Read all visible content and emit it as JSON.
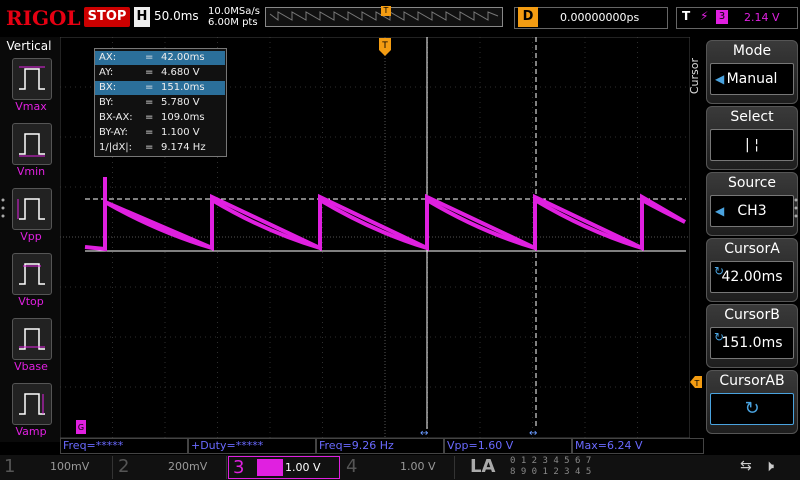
{
  "top": {
    "logo": "RIGOL",
    "status": "STOP",
    "horizontal_badge": "H",
    "timebase": "50.0ms",
    "sample_rate": "10.0MSa/s",
    "memory_depth": "6.00M pts",
    "delay_badge": "D",
    "delay_value": "0.00000000ps",
    "trigger_badge": "T",
    "trigger_source": "3",
    "trigger_level": "2.14 V"
  },
  "left_panel": {
    "title": "Vertical",
    "items": [
      {
        "label": "Vmax"
      },
      {
        "label": "Vmin"
      },
      {
        "label": "Vpp"
      },
      {
        "label": "Vtop"
      },
      {
        "label": "Vbase"
      },
      {
        "label": "Vamp"
      }
    ]
  },
  "cursor_readout": [
    {
      "key": "AX:",
      "value": "42.00ms"
    },
    {
      "key": "AY:",
      "value": "4.680 V"
    },
    {
      "key": "BX:",
      "value": "151.0ms"
    },
    {
      "key": "BY:",
      "value": "5.780 V"
    },
    {
      "key": "BX-AX:",
      "value": "109.0ms"
    },
    {
      "key": "BY-AY:",
      "value": "1.100 V"
    },
    {
      "key": "1/|dX|:",
      "value": "9.174 Hz"
    }
  ],
  "right_panel": {
    "side_label": "Cursor",
    "mode_label": "Mode",
    "mode_value": "Manual",
    "select_label": "Select",
    "select_value": "|    ¦",
    "source_label": "Source",
    "source_value": "CH3",
    "cursorA_label": "CursorA",
    "cursorA_value": "42.00ms",
    "cursorB_label": "CursorB",
    "cursorB_value": "151.0ms",
    "cursorAB_label": "CursorAB"
  },
  "measurements": {
    "freq_star": "Freq=*****",
    "duty": "+Duty=*****",
    "freq": "Freq=9.26 Hz",
    "vpp": "Vpp=1.60 V",
    "max": "Max=6.24 V"
  },
  "channels": [
    {
      "num": "1",
      "scale": "100mV",
      "active": false
    },
    {
      "num": "2",
      "scale": "200mV",
      "active": false
    },
    {
      "num": "3",
      "scale": "1.00 V",
      "active": true
    },
    {
      "num": "4",
      "scale": "1.00 V",
      "active": false
    }
  ],
  "la_label": "LA",
  "la_digits_top": "0 1 2 3  4 5 6 7",
  "la_digits_bottom": "8 9 0 1  2 3 4 5",
  "colors": {
    "ch3": "#e020e0",
    "trigger": "#f39c12",
    "accent": "#2b6f9a"
  }
}
